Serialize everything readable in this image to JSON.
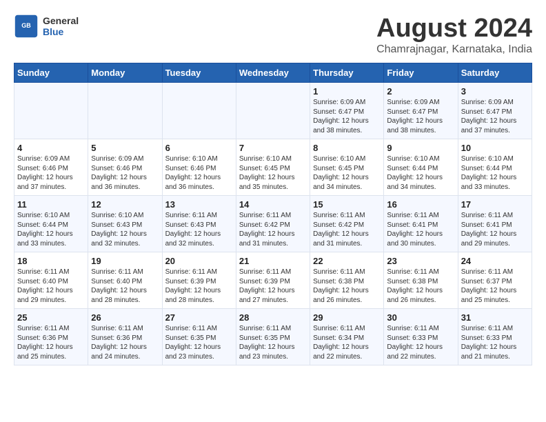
{
  "header": {
    "logo_general": "General",
    "logo_blue": "Blue",
    "title": "August 2024",
    "subtitle": "Chamrajnagar, Karnataka, India"
  },
  "weekdays": [
    "Sunday",
    "Monday",
    "Tuesday",
    "Wednesday",
    "Thursday",
    "Friday",
    "Saturday"
  ],
  "weeks": [
    [
      {
        "day": "",
        "info": ""
      },
      {
        "day": "",
        "info": ""
      },
      {
        "day": "",
        "info": ""
      },
      {
        "day": "",
        "info": ""
      },
      {
        "day": "1",
        "info": "Sunrise: 6:09 AM\nSunset: 6:47 PM\nDaylight: 12 hours\nand 38 minutes."
      },
      {
        "day": "2",
        "info": "Sunrise: 6:09 AM\nSunset: 6:47 PM\nDaylight: 12 hours\nand 38 minutes."
      },
      {
        "day": "3",
        "info": "Sunrise: 6:09 AM\nSunset: 6:47 PM\nDaylight: 12 hours\nand 37 minutes."
      }
    ],
    [
      {
        "day": "4",
        "info": "Sunrise: 6:09 AM\nSunset: 6:46 PM\nDaylight: 12 hours\nand 37 minutes."
      },
      {
        "day": "5",
        "info": "Sunrise: 6:09 AM\nSunset: 6:46 PM\nDaylight: 12 hours\nand 36 minutes."
      },
      {
        "day": "6",
        "info": "Sunrise: 6:10 AM\nSunset: 6:46 PM\nDaylight: 12 hours\nand 36 minutes."
      },
      {
        "day": "7",
        "info": "Sunrise: 6:10 AM\nSunset: 6:45 PM\nDaylight: 12 hours\nand 35 minutes."
      },
      {
        "day": "8",
        "info": "Sunrise: 6:10 AM\nSunset: 6:45 PM\nDaylight: 12 hours\nand 34 minutes."
      },
      {
        "day": "9",
        "info": "Sunrise: 6:10 AM\nSunset: 6:44 PM\nDaylight: 12 hours\nand 34 minutes."
      },
      {
        "day": "10",
        "info": "Sunrise: 6:10 AM\nSunset: 6:44 PM\nDaylight: 12 hours\nand 33 minutes."
      }
    ],
    [
      {
        "day": "11",
        "info": "Sunrise: 6:10 AM\nSunset: 6:44 PM\nDaylight: 12 hours\nand 33 minutes."
      },
      {
        "day": "12",
        "info": "Sunrise: 6:10 AM\nSunset: 6:43 PM\nDaylight: 12 hours\nand 32 minutes."
      },
      {
        "day": "13",
        "info": "Sunrise: 6:11 AM\nSunset: 6:43 PM\nDaylight: 12 hours\nand 32 minutes."
      },
      {
        "day": "14",
        "info": "Sunrise: 6:11 AM\nSunset: 6:42 PM\nDaylight: 12 hours\nand 31 minutes."
      },
      {
        "day": "15",
        "info": "Sunrise: 6:11 AM\nSunset: 6:42 PM\nDaylight: 12 hours\nand 31 minutes."
      },
      {
        "day": "16",
        "info": "Sunrise: 6:11 AM\nSunset: 6:41 PM\nDaylight: 12 hours\nand 30 minutes."
      },
      {
        "day": "17",
        "info": "Sunrise: 6:11 AM\nSunset: 6:41 PM\nDaylight: 12 hours\nand 29 minutes."
      }
    ],
    [
      {
        "day": "18",
        "info": "Sunrise: 6:11 AM\nSunset: 6:40 PM\nDaylight: 12 hours\nand 29 minutes."
      },
      {
        "day": "19",
        "info": "Sunrise: 6:11 AM\nSunset: 6:40 PM\nDaylight: 12 hours\nand 28 minutes."
      },
      {
        "day": "20",
        "info": "Sunrise: 6:11 AM\nSunset: 6:39 PM\nDaylight: 12 hours\nand 28 minutes."
      },
      {
        "day": "21",
        "info": "Sunrise: 6:11 AM\nSunset: 6:39 PM\nDaylight: 12 hours\nand 27 minutes."
      },
      {
        "day": "22",
        "info": "Sunrise: 6:11 AM\nSunset: 6:38 PM\nDaylight: 12 hours\nand 26 minutes."
      },
      {
        "day": "23",
        "info": "Sunrise: 6:11 AM\nSunset: 6:38 PM\nDaylight: 12 hours\nand 26 minutes."
      },
      {
        "day": "24",
        "info": "Sunrise: 6:11 AM\nSunset: 6:37 PM\nDaylight: 12 hours\nand 25 minutes."
      }
    ],
    [
      {
        "day": "25",
        "info": "Sunrise: 6:11 AM\nSunset: 6:36 PM\nDaylight: 12 hours\nand 25 minutes."
      },
      {
        "day": "26",
        "info": "Sunrise: 6:11 AM\nSunset: 6:36 PM\nDaylight: 12 hours\nand 24 minutes."
      },
      {
        "day": "27",
        "info": "Sunrise: 6:11 AM\nSunset: 6:35 PM\nDaylight: 12 hours\nand 23 minutes."
      },
      {
        "day": "28",
        "info": "Sunrise: 6:11 AM\nSunset: 6:35 PM\nDaylight: 12 hours\nand 23 minutes."
      },
      {
        "day": "29",
        "info": "Sunrise: 6:11 AM\nSunset: 6:34 PM\nDaylight: 12 hours\nand 22 minutes."
      },
      {
        "day": "30",
        "info": "Sunrise: 6:11 AM\nSunset: 6:33 PM\nDaylight: 12 hours\nand 22 minutes."
      },
      {
        "day": "31",
        "info": "Sunrise: 6:11 AM\nSunset: 6:33 PM\nDaylight: 12 hours\nand 21 minutes."
      }
    ]
  ]
}
